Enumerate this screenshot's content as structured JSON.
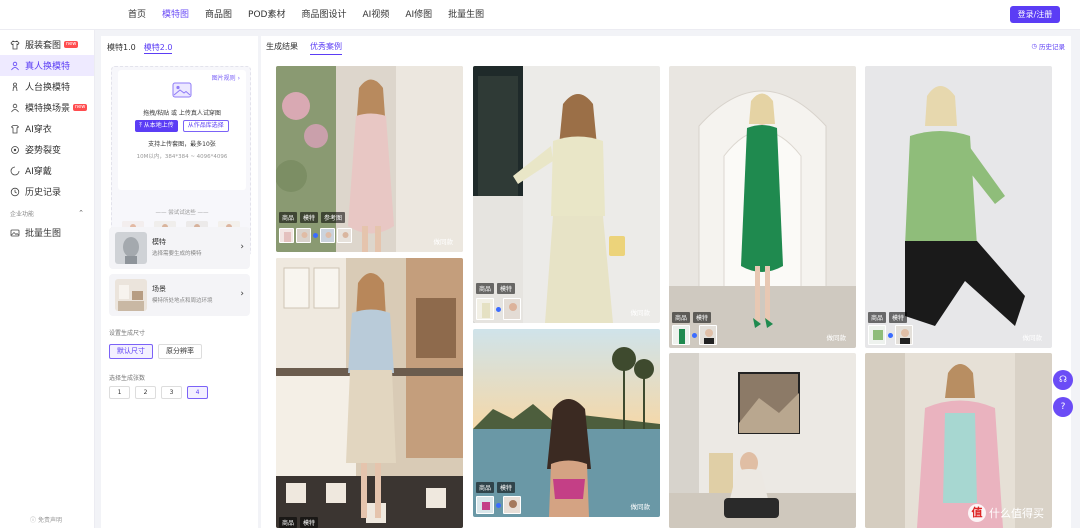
{
  "topnav": [
    "首页",
    "模特图",
    "商品图",
    "POD素材",
    "商品图设计",
    "AI视频",
    "AI修图",
    "批量生图"
  ],
  "topnav_active": 1,
  "login_label": "登录/注册",
  "sidebar": {
    "items": [
      {
        "label": "服装套图",
        "icon": "shirt-icon",
        "badge": "new"
      },
      {
        "label": "真人换模特",
        "icon": "model-swap-icon",
        "active": true
      },
      {
        "label": "人台换模特",
        "icon": "mannequin-icon"
      },
      {
        "label": "模特换场景",
        "icon": "scene-icon",
        "badge": "new"
      },
      {
        "label": "AI穿衣",
        "icon": "clothes-icon"
      },
      {
        "label": "姿势裂变",
        "icon": "pose-icon"
      },
      {
        "label": "AI穿戴",
        "icon": "wear-icon"
      },
      {
        "label": "历史记录",
        "icon": "history-icon"
      }
    ],
    "section_label": "企业功能",
    "enterprise_items": [
      {
        "label": "批量生图",
        "icon": "batch-icon"
      }
    ],
    "disclaimer": "免责声明"
  },
  "config": {
    "version_tabs": [
      "模特1.0",
      "模特2.0"
    ],
    "upload": {
      "rule_link": "图片规则",
      "hint": "拖拽/粘贴 或 上传真人试穿图",
      "btn_local": "从本地上传",
      "btn_library": "从作品库选择",
      "support": "支持上传套图，最多10张",
      "size": "10M以内，384*384 ~ 4096*4096",
      "try_label": "尝试试这些"
    },
    "model_card": {
      "title": "模特",
      "sub": "选择需要生成的模特"
    },
    "scene_card": {
      "title": "场景",
      "sub": "模特所处地点和周边环境"
    },
    "size_label": "设置生成尺寸",
    "size_options": [
      "默认尺寸",
      "原分辨率"
    ],
    "count_label": "选择生成张数",
    "count_options": [
      "1",
      "2",
      "3",
      "4"
    ]
  },
  "results": {
    "tabs": [
      "生成结果",
      "优秀案例"
    ],
    "history": "历史记录",
    "tag_goods": "商品",
    "tag_model": "模特",
    "tag_ref": "参考图",
    "same_style": "做同款"
  },
  "watermark": "什么值得买",
  "watermark_glyph": "值"
}
